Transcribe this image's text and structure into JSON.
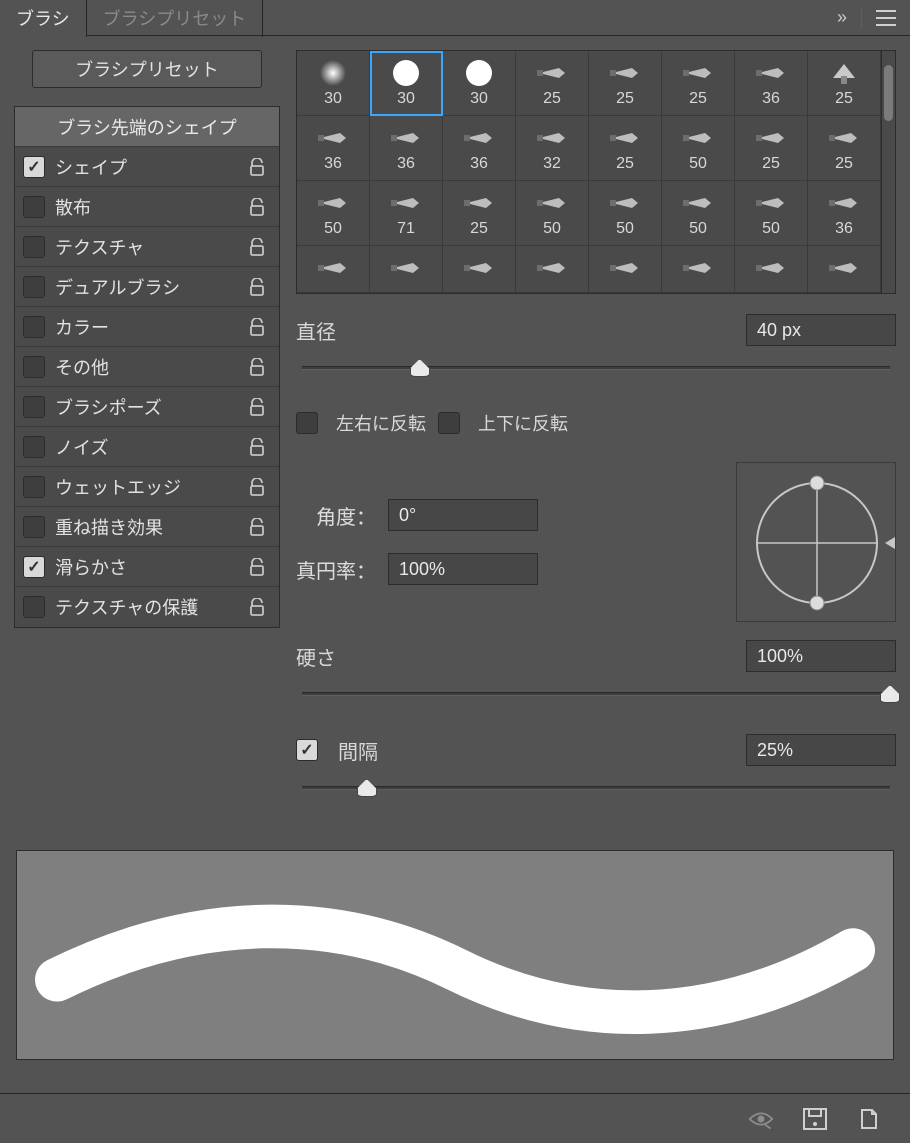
{
  "tabs": {
    "brushes": "ブラシ",
    "presets": "ブラシプリセット"
  },
  "preset_button": "ブラシプリセット",
  "options_header": "ブラシ先端のシェイプ",
  "options": [
    {
      "label": "シェイプ",
      "checked": true,
      "lock": true
    },
    {
      "label": "散布",
      "checked": false,
      "lock": true
    },
    {
      "label": "テクスチャ",
      "checked": false,
      "lock": true
    },
    {
      "label": "デュアルブラシ",
      "checked": false,
      "lock": true
    },
    {
      "label": "カラー",
      "checked": false,
      "lock": true
    },
    {
      "label": "その他",
      "checked": false,
      "lock": true
    },
    {
      "label": "ブラシポーズ",
      "checked": false,
      "lock": true
    },
    {
      "label": "ノイズ",
      "checked": false,
      "lock": true
    },
    {
      "label": "ウェットエッジ",
      "checked": false,
      "lock": true
    },
    {
      "label": "重ね描き効果",
      "checked": false,
      "lock": true
    },
    {
      "label": "滑らかさ",
      "checked": true,
      "lock": true
    },
    {
      "label": "テクスチャの保護",
      "checked": false,
      "lock": true
    }
  ],
  "grid": {
    "selected_index": 1,
    "cells": [
      {
        "size": "30",
        "kind": "soft"
      },
      {
        "size": "30",
        "kind": "hard"
      },
      {
        "size": "30",
        "kind": "hard"
      },
      {
        "size": "25",
        "kind": "tip"
      },
      {
        "size": "25",
        "kind": "tip"
      },
      {
        "size": "25",
        "kind": "tip"
      },
      {
        "size": "36",
        "kind": "tip"
      },
      {
        "size": "25",
        "kind": "fan"
      },
      {
        "size": "36",
        "kind": "tip"
      },
      {
        "size": "36",
        "kind": "tip"
      },
      {
        "size": "36",
        "kind": "tip"
      },
      {
        "size": "32",
        "kind": "tip"
      },
      {
        "size": "25",
        "kind": "tip"
      },
      {
        "size": "50",
        "kind": "tip"
      },
      {
        "size": "25",
        "kind": "tip"
      },
      {
        "size": "25",
        "kind": "tip"
      },
      {
        "size": "50",
        "kind": "tip"
      },
      {
        "size": "71",
        "kind": "tip"
      },
      {
        "size": "25",
        "kind": "tip"
      },
      {
        "size": "50",
        "kind": "tip"
      },
      {
        "size": "50",
        "kind": "tip"
      },
      {
        "size": "50",
        "kind": "tip"
      },
      {
        "size": "50",
        "kind": "tip"
      },
      {
        "size": "36",
        "kind": "tip"
      },
      {
        "size": "",
        "kind": "tip"
      },
      {
        "size": "",
        "kind": "tip"
      },
      {
        "size": "",
        "kind": "tip"
      },
      {
        "size": "",
        "kind": "tip"
      },
      {
        "size": "",
        "kind": "tip"
      },
      {
        "size": "",
        "kind": "tip"
      },
      {
        "size": "",
        "kind": "tip"
      },
      {
        "size": "",
        "kind": "tip"
      }
    ]
  },
  "labels": {
    "diameter": "直径",
    "flip_x": "左右に反転",
    "flip_y": "上下に反転",
    "angle": "角度：",
    "roundness": "真円率：",
    "hardness": "硬さ",
    "spacing": "間隔"
  },
  "values": {
    "diameter": "40 px",
    "diameter_pct": 20,
    "flip_x": false,
    "flip_y": false,
    "angle": "0°",
    "roundness": "100%",
    "hardness": "100%",
    "hardness_pct": 100,
    "spacing_checked": true,
    "spacing": "25%",
    "spacing_pct": 11
  }
}
